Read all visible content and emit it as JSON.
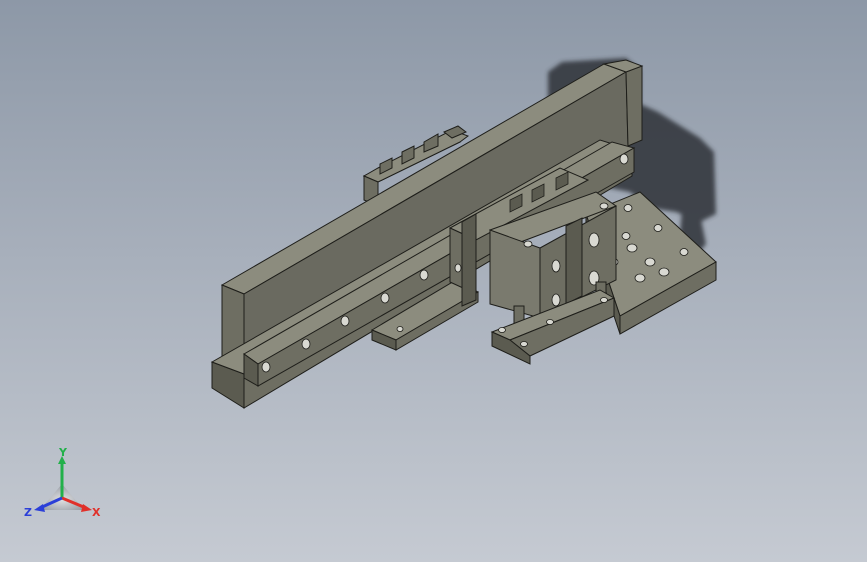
{
  "viewport": {
    "background_top": "#8d98a7",
    "background_bottom": "#c5cad2"
  },
  "model": {
    "part_face_color": "#6e6e62",
    "part_top_color": "#8c8c7e",
    "part_side_color": "#5b5b50",
    "edge_color": "#1e1e1a",
    "shadow_color": "#2f3338"
  },
  "triad": {
    "x_label": "X",
    "y_label": "Y",
    "z_label": "Z",
    "x_color": "#e0302a",
    "y_color": "#22b04a",
    "z_color": "#2b3fd8"
  }
}
